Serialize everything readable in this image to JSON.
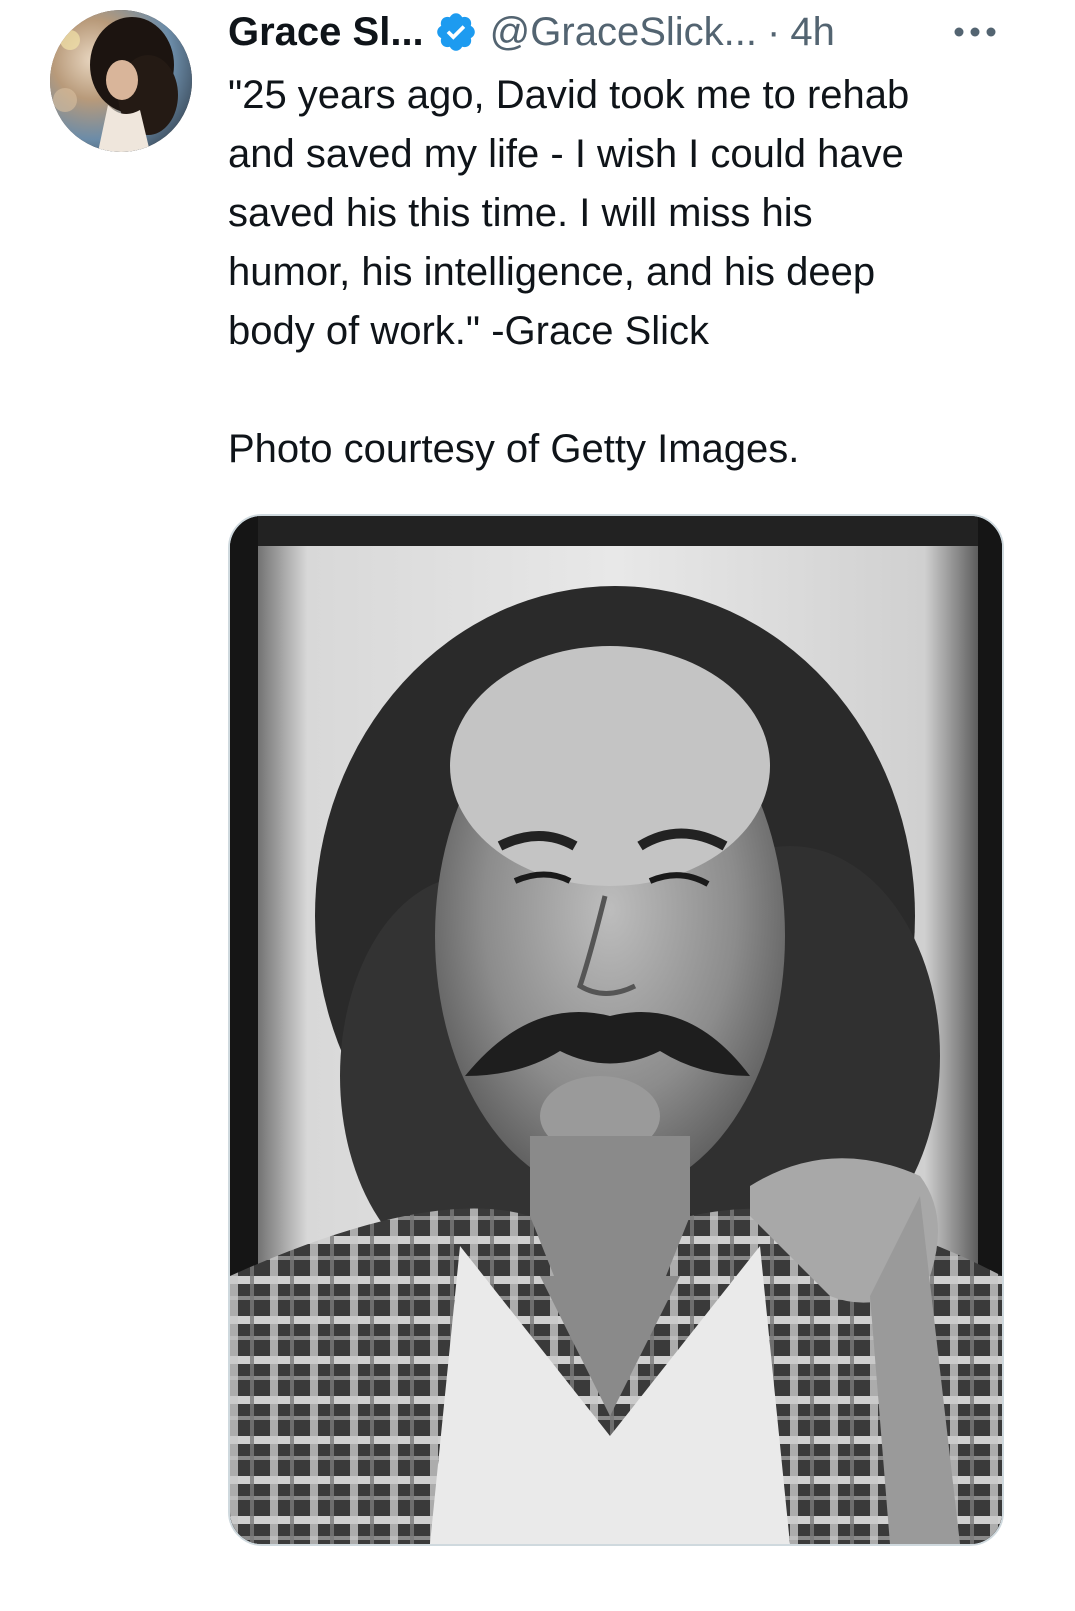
{
  "tweet": {
    "author": {
      "display_name": "Grace Sl...",
      "handle": "@GraceSlick...",
      "verified_icon": "verified-badge-icon",
      "avatar_icon": "avatar"
    },
    "separator": "·",
    "time": "4h",
    "more_icon": "more-options-icon",
    "text": "\"25 years ago, David took me to rehab\nand saved my life - I wish I could have\nsaved his this time. I will miss his\nhumor, his intelligence, and his deep\nbody of work.\" -Grace Slick",
    "credit": "Photo courtesy of Getty Images.",
    "media": {
      "kind": "photo",
      "style": "black-and-white portrait"
    }
  },
  "colors": {
    "text_primary": "#0f1419",
    "text_secondary": "#536471",
    "verified_blue": "#1d9bf0",
    "media_border": "#cfd9de"
  }
}
